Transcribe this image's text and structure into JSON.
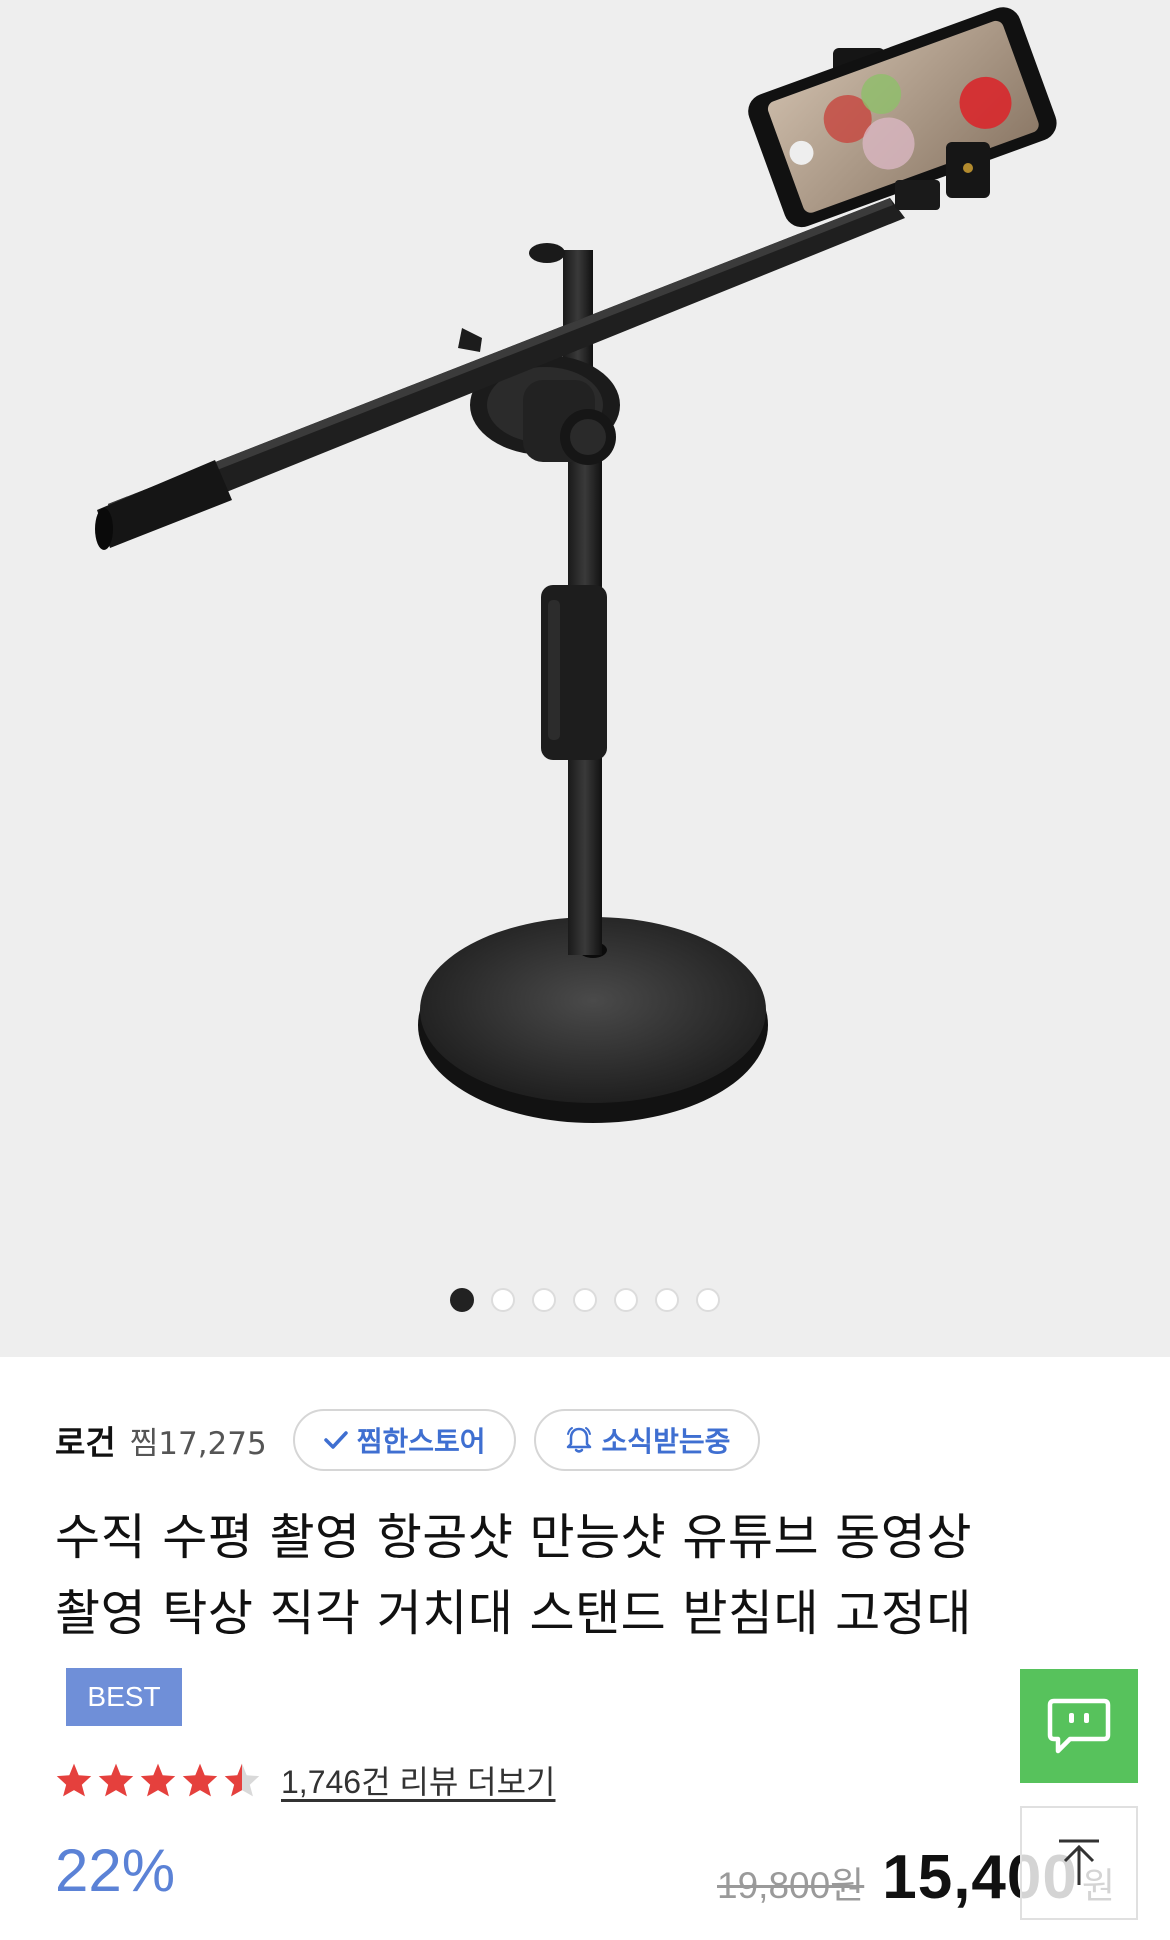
{
  "gallery": {
    "image_alt": "Black desktop stand with horizontal boom arm and smartphone holder",
    "page_count": 7,
    "active_index": 0
  },
  "store": {
    "name": "로건",
    "wish_count": "찜17,275",
    "favorite_label": "찜한스토어",
    "subscribe_label": "소식받는중"
  },
  "product": {
    "title_line1": "수직 수평 촬영 항공샷 만능샷 유튜브 동영상",
    "title_line2": "촬영 탁상 직각 거치대 스탠드 받침대 고정대",
    "badge": "BEST",
    "rating": 4.5,
    "review_link": "1,746건 리뷰 더보기",
    "discount": "22%",
    "original_price": "19,800원",
    "sale_price": "15,400",
    "price_unit": "원"
  },
  "colors": {
    "accent_blue": "#3f6fd1",
    "badge_blue": "#6f8fd8",
    "star_red": "#e5403d",
    "chat_green": "#57c25c"
  },
  "icons": {
    "favorite": "check-icon",
    "subscribe": "bell-icon",
    "chat": "chat-icon",
    "scroll_top": "arrow-up-icon"
  }
}
